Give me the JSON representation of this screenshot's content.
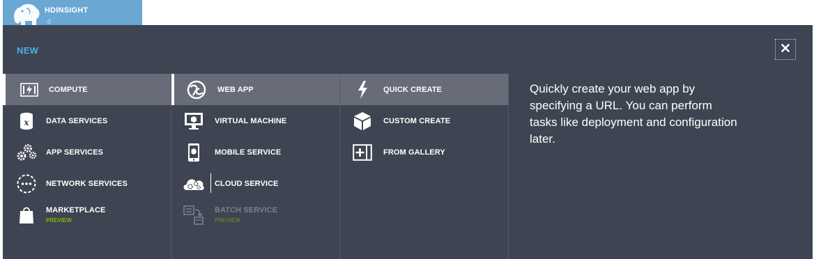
{
  "tile": {
    "title": "HDINSIGHT",
    "count": "0"
  },
  "panel": {
    "title": "NEW"
  },
  "categories": [
    {
      "label": "COMPUTE",
      "icon": "compute-icon",
      "selected": true
    },
    {
      "label": "DATA SERVICES",
      "icon": "data-services-icon"
    },
    {
      "label": "APP SERVICES",
      "icon": "app-services-icon"
    },
    {
      "label": "NETWORK SERVICES",
      "icon": "network-services-icon"
    },
    {
      "label": "MARKETPLACE",
      "sub": "PREVIEW",
      "icon": "marketplace-icon"
    }
  ],
  "services": [
    {
      "label": "WEB APP",
      "icon": "web-app-icon",
      "selected": true
    },
    {
      "label": "VIRTUAL MACHINE",
      "icon": "virtual-machine-icon"
    },
    {
      "label": "MOBILE SERVICE",
      "icon": "mobile-service-icon"
    },
    {
      "label": "CLOUD SERVICE",
      "icon": "cloud-service-icon"
    },
    {
      "label": "BATCH SERVICE",
      "sub": "PREVIEW",
      "icon": "batch-service-icon",
      "disabled": true
    }
  ],
  "options": [
    {
      "label": "QUICK CREATE",
      "icon": "lightning-icon",
      "selected": true
    },
    {
      "label": "CUSTOM CREATE",
      "icon": "box-icon"
    },
    {
      "label": "FROM GALLERY",
      "icon": "gallery-plus-icon"
    }
  ],
  "description": "Quickly create your web app by specifying a URL. You can perform tasks like deployment and configuration later.",
  "colors": {
    "panel_bg": "#3e4451",
    "selected_bg": "#676c78",
    "accent_blue": "#48b0e8",
    "preview_green": "#7fba00",
    "tile_bg": "#6aa7d3"
  }
}
